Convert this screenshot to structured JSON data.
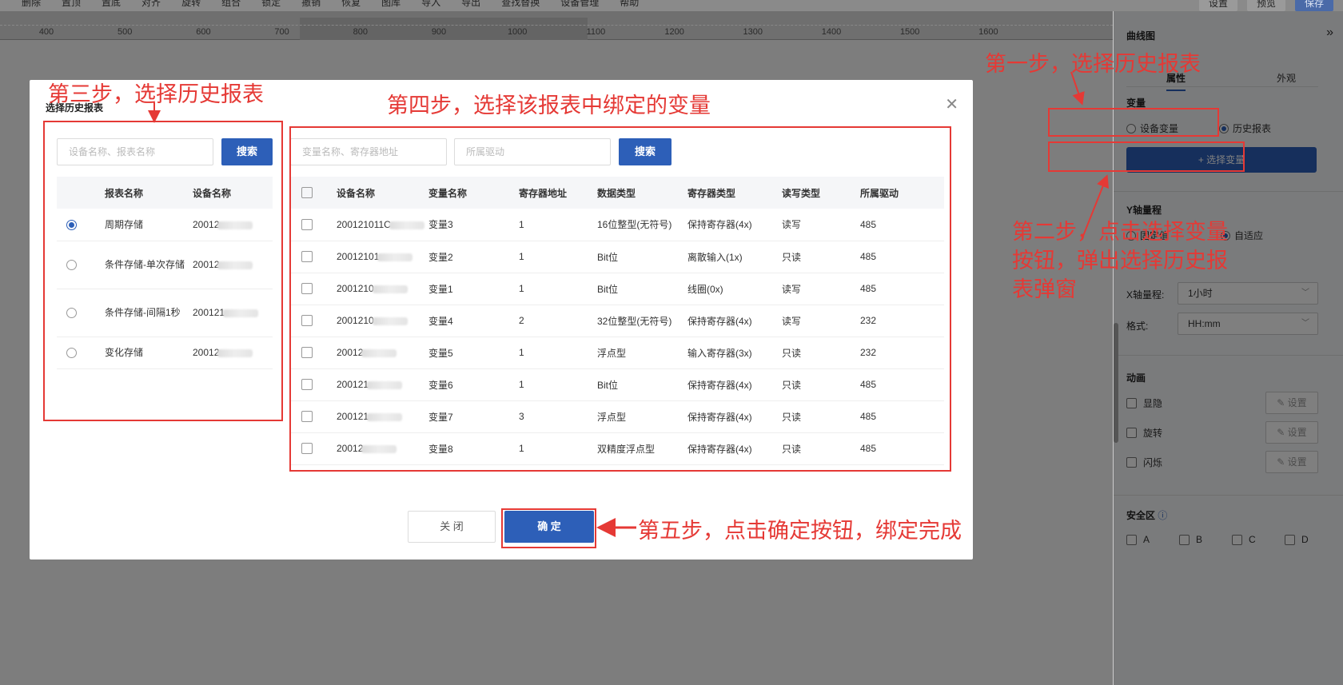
{
  "toolbar": {
    "items": [
      "删除",
      "置顶",
      "置底",
      "对齐",
      "旋转",
      "组合",
      "锁定",
      "撤销",
      "恢复",
      "图库",
      "导入",
      "导出",
      "查找替换",
      "设备管理",
      "帮助"
    ],
    "right_buttons": [
      "设置",
      "预览",
      "保存"
    ]
  },
  "ruler": {
    "labels": [
      "400",
      "500",
      "600",
      "700",
      "800",
      "900",
      "1000",
      "1100",
      "1200",
      "1300",
      "1400",
      "1500",
      "1600"
    ]
  },
  "right_panel": {
    "title": "曲线图",
    "collapse_icon": "»",
    "tabs": [
      "属性",
      "外观"
    ],
    "variable_label": "变量",
    "radio_device": "设备变量",
    "radio_history": "历史报表",
    "select_variable_button": "+ 选择变量",
    "y_axis_label": "Y轴量程",
    "y_radio_fixed": "固定值",
    "y_radio_auto": "自适应",
    "range_label": "X轴量程:",
    "range_value": "1小时",
    "format_label": "格式:",
    "format_value": "HH:mm",
    "animation_label": "动画",
    "animations": [
      "显隐",
      "旋转",
      "闪烁"
    ],
    "set_label": "✎ 设置",
    "safety_label": "安全区",
    "safety_options": [
      "A",
      "B",
      "C",
      "D"
    ]
  },
  "modal": {
    "title": "选择历史报表",
    "left": {
      "search_placeholder": "设备名称、报表名称",
      "search_button": "搜索",
      "headers": [
        "报表名称",
        "设备名称"
      ],
      "rows": [
        {
          "name": "周期存储",
          "device": "20012",
          "selected": true
        },
        {
          "name": "条件存储-单次存储",
          "device": "20012",
          "selected": false
        },
        {
          "name": "条件存储-间隔1秒",
          "device": "200121",
          "selected": false
        },
        {
          "name": "变化存储",
          "device": "20012",
          "selected": false
        }
      ]
    },
    "right": {
      "search_placeholder": "变量名称、寄存器地址",
      "driver_placeholder": "所属驱动",
      "search_button": "搜索",
      "headers": [
        "设备名称",
        "变量名称",
        "寄存器地址",
        "数据类型",
        "寄存器类型",
        "读写类型",
        "所属驱动"
      ],
      "rows": [
        {
          "device": "200121011C",
          "var": "变量3",
          "addr": "1",
          "dtype": "16位整型(无符号)",
          "rtype": "保持寄存器(4x)",
          "rw": "读写",
          "driver": "485"
        },
        {
          "device": "20012101",
          "var": "变量2",
          "addr": "1",
          "dtype": "Bit位",
          "rtype": "离散输入(1x)",
          "rw": "只读",
          "driver": "485"
        },
        {
          "device": "2001210",
          "var": "变量1",
          "addr": "1",
          "dtype": "Bit位",
          "rtype": "线圈(0x)",
          "rw": "读写",
          "driver": "485"
        },
        {
          "device": "2001210",
          "var": "变量4",
          "addr": "2",
          "dtype": "32位整型(无符号)",
          "rtype": "保持寄存器(4x)",
          "rw": "读写",
          "driver": "232"
        },
        {
          "device": "20012",
          "var": "变量5",
          "addr": "1",
          "dtype": "浮点型",
          "rtype": "输入寄存器(3x)",
          "rw": "只读",
          "driver": "232"
        },
        {
          "device": "200121",
          "var": "变量6",
          "addr": "1",
          "dtype": "Bit位",
          "rtype": "保持寄存器(4x)",
          "rw": "只读",
          "driver": "485"
        },
        {
          "device": "200121",
          "var": "变量7",
          "addr": "3",
          "dtype": "浮点型",
          "rtype": "保持寄存器(4x)",
          "rw": "只读",
          "driver": "485"
        },
        {
          "device": "20012",
          "var": "变量8",
          "addr": "1",
          "dtype": "双精度浮点型",
          "rtype": "保持寄存器(4x)",
          "rw": "只读",
          "driver": "485"
        }
      ]
    },
    "close_button": "关 闭",
    "confirm_button": "确 定"
  },
  "annotations": {
    "step1": "第一步，选择历史报表",
    "step2_line1": "第二步，点击选择变量",
    "step2_line2": "按钮，弹出选择历史报",
    "step2_line3": "表弹窗",
    "step3": "第三步，选择历史报表",
    "step4": "第四步，选择该报表中绑定的变量",
    "step5": "第五步，点击确定按钮，绑定完成"
  }
}
